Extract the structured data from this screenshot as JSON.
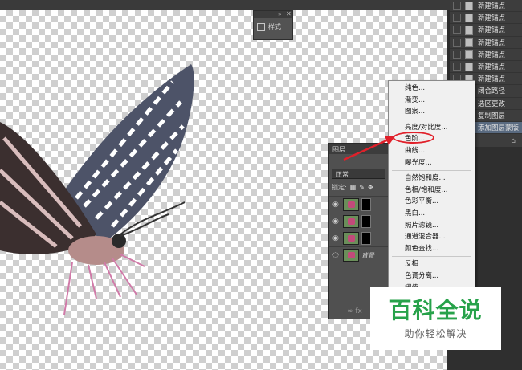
{
  "styles_panel": {
    "label": "样式"
  },
  "history": {
    "items": [
      {
        "label": "新建锚点",
        "selected": false
      },
      {
        "label": "新建锚点",
        "selected": false
      },
      {
        "label": "新建锚点",
        "selected": false
      },
      {
        "label": "新建锚点",
        "selected": false
      },
      {
        "label": "新建锚点",
        "selected": false
      },
      {
        "label": "新建锚点",
        "selected": false
      },
      {
        "label": "新建锚点",
        "selected": false
      },
      {
        "label": "闭合路径",
        "selected": false
      },
      {
        "label": "选区更改",
        "selected": false
      },
      {
        "label": "复制图层",
        "selected": false
      },
      {
        "label": "添加图层蒙版",
        "selected": true
      }
    ]
  },
  "layers": {
    "tab_label": "图层",
    "blend_mode": "正常",
    "lock_label": "锁定:",
    "background_label": "背景"
  },
  "menu": {
    "groups": [
      [
        "纯色...",
        "渐变...",
        "图案..."
      ],
      [
        "亮度/对比度...",
        "色阶...",
        "曲线...",
        "曝光度..."
      ],
      [
        "自然饱和度...",
        "色相/饱和度...",
        "色彩平衡...",
        "黑白...",
        "照片滤镜...",
        "通道混合器...",
        "颜色查找..."
      ],
      [
        "反相",
        "色调分离...",
        "阈值..."
      ]
    ]
  },
  "watermark": {
    "title": "百科全说",
    "subtitle": "助你轻松解决"
  },
  "colors": {
    "highlight_red": "#e0202a",
    "watermark_green": "#27a24a",
    "history_selected": "#596a80"
  }
}
